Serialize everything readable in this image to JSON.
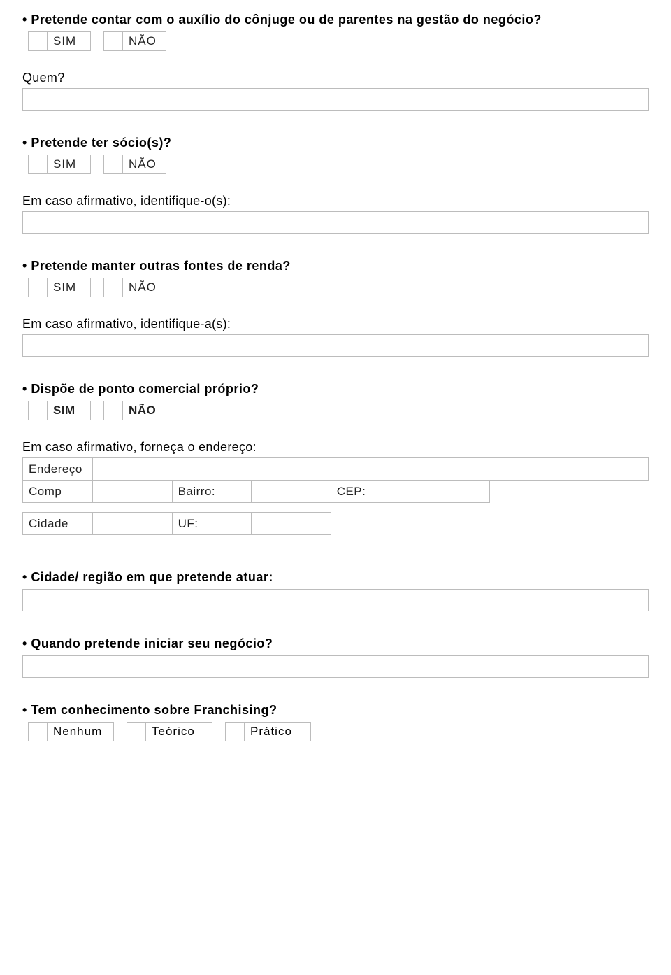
{
  "yn": {
    "sim": "SIM",
    "nao": "NÃO",
    "sim_b": "SIM",
    "nao_b": "NÃO"
  },
  "q1": {
    "text": "Pretende contar com o auxílio do cônjuge ou de parentes na gestão do negócio?",
    "sub": "Quem?"
  },
  "q2": {
    "text": "Pretende ter sócio(s)?",
    "sub": "Em caso afirmativo, identifique-o(s):"
  },
  "q3": {
    "text": "Pretende manter outras fontes de renda?",
    "sub": "Em caso afirmativo, identifique-a(s):"
  },
  "q4": {
    "text": "Dispõe de ponto comercial próprio?",
    "sub": "Em caso afirmativo, forneça o endereço:",
    "addr": {
      "endereco": "Endereço",
      "comp": "Comp",
      "bairro": "Bairro:",
      "cep": "CEP:",
      "cidade": "Cidade",
      "uf": "UF:"
    }
  },
  "q5": {
    "text": "Cidade/ região em que pretende atuar:"
  },
  "q6": {
    "text": "Quando pretende iniciar seu negócio?"
  },
  "q7": {
    "text": "Tem conhecimento sobre Franchising?",
    "opts": {
      "nenhum": "Nenhum",
      "teorico": "Teórico",
      "pratico": "Prático"
    }
  }
}
